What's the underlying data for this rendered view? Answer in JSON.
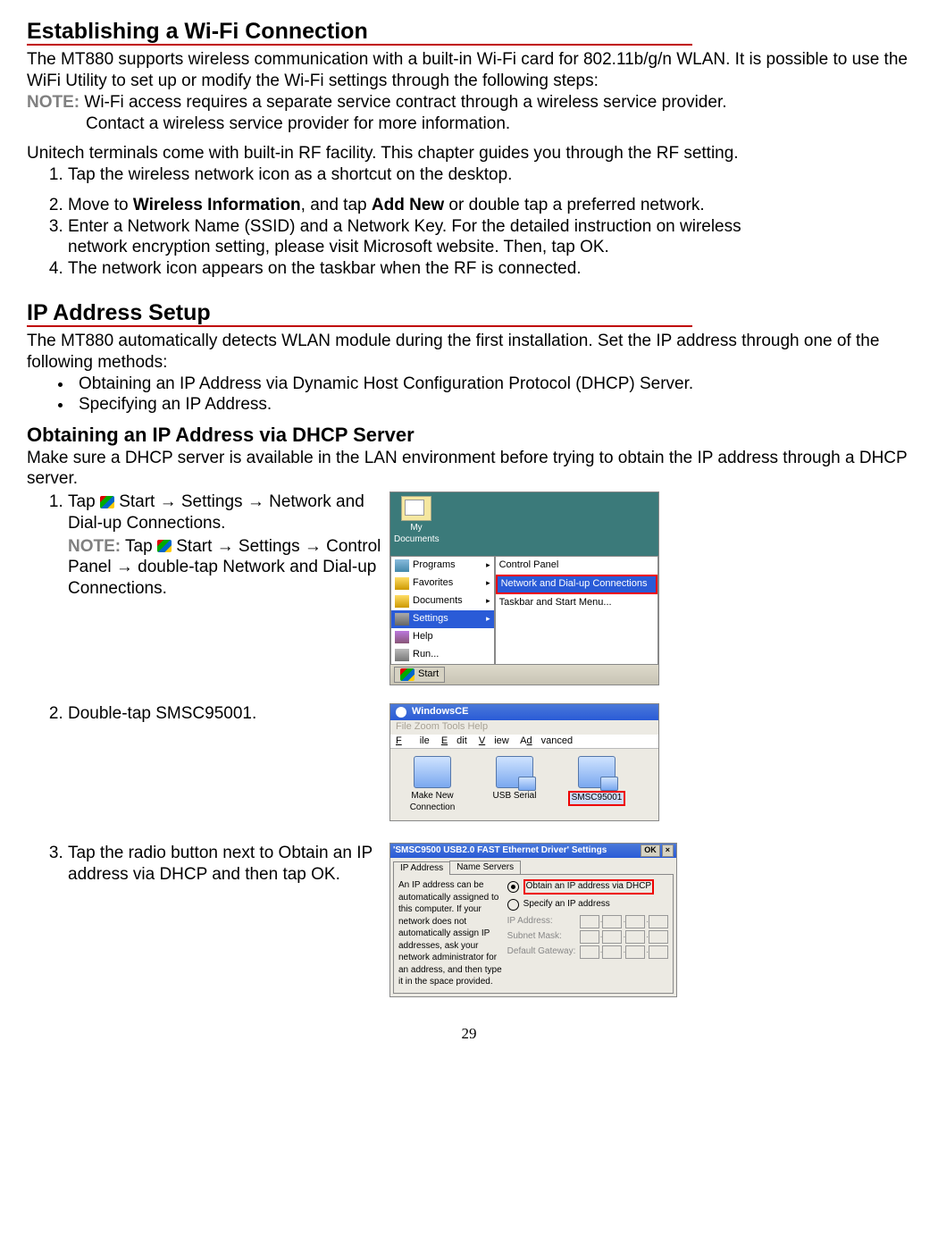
{
  "page_number": "29",
  "section1": {
    "heading": "Establishing a Wi-Fi Connection",
    "para1": "The MT880 supports wireless communication with a built-in Wi-Fi card for 802.11b/g/n WLAN. It is possible to use the WiFi Utility to set up or modify the Wi-Fi settings through the following steps:",
    "note_label": "NOTE:",
    "note_line1": " Wi-Fi access requires a separate service contract through a wireless service provider.",
    "note_line2": "Contact a wireless service provider for more information.",
    "para2": "Unitech terminals come with built-in RF facility. This chapter guides you through the RF setting.",
    "li1": "Tap the wireless network icon as a shortcut on the desktop.",
    "li2_pre": "Move to ",
    "li2_b1": "Wireless Information",
    "li2_mid": ", and tap ",
    "li2_b2": "Add New",
    "li2_post": " or double tap a preferred network.",
    "li3": "Enter a Network Name (SSID) and a Network Key. For the detailed instruction on wireless network encryption setting, please visit Microsoft website. Then, tap OK.",
    "li4": "The network icon appears on the taskbar when the RF is connected."
  },
  "section2": {
    "heading": "IP Address Setup",
    "para1": "The MT880 automatically detects WLAN module during the first installation. Set the IP address through one of the following methods:",
    "bullet1": "Obtaining an IP Address via Dynamic Host Configuration Protocol (DHCP) Server.",
    "bullet2": "Specifying an IP Address.",
    "sub_heading": "Obtaining an IP Address via DHCP Server",
    "para2": "Make sure a DHCP server is available in the LAN environment before trying to obtain the IP address through a DHCP server."
  },
  "step1": {
    "text_a": "Tap ",
    "text_b": " Start → Settings → Network and Dial-up Connections.",
    "note_label": "NOTE:",
    "note_a": " Tap ",
    "note_b": " Start → Settings → Control Panel → double-tap Network and Dial-up Connections."
  },
  "step2": {
    "text": "Double-tap SMSC95001."
  },
  "step3": {
    "text": "Tap the radio button next to Obtain an IP address via DHCP and then tap OK."
  },
  "ss1": {
    "mydocs": "My Documents",
    "programs": "Programs",
    "favorites": "Favorites",
    "documents": "Documents",
    "settings": "Settings",
    "help": "Help",
    "run": "Run...",
    "start": "Start",
    "controlpanel": "Control Panel",
    "netdial": "Network and Dial-up Connections",
    "taskbar": "Taskbar and Start Menu..."
  },
  "ss2": {
    "title": "WindowsCE",
    "faint": "File   Zoom   Tools   Help",
    "file": "File",
    "edit": "Edit",
    "view": "View",
    "adv": "Advanced",
    "makenew": "Make New Connection",
    "usbserial": "USB Serial",
    "smsc": "SMSC95001"
  },
  "ss3": {
    "title": "'SMSC9500 USB2.0 FAST Ethernet Driver' Settings",
    "ok": "OK",
    "tab_ip": "IP Address",
    "tab_ns": "Name Servers",
    "lefttext": "An IP address can be automatically assigned to this computer. If your network does not automatically assign IP addresses, ask your network administrator for an address, and then type it in the space provided.",
    "opt1": "Obtain an IP address via DHCP",
    "opt2": "Specify an IP address",
    "ip": "IP Address:",
    "mask": "Subnet Mask:",
    "gw": "Default Gateway:"
  }
}
